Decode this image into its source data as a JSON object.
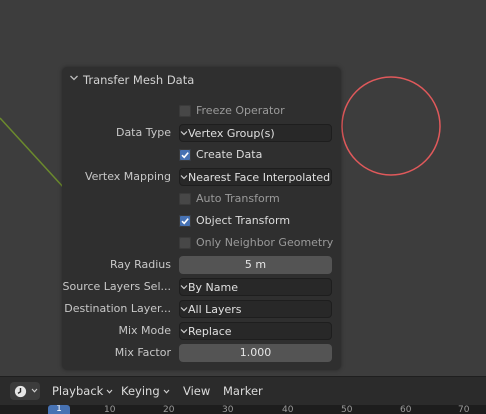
{
  "operator_panel": {
    "title": "Transfer Mesh Data",
    "freeze_operator": {
      "label": "Freeze Operator",
      "checked": false
    },
    "data_type": {
      "label": "Data Type",
      "value": "Vertex Group(s)"
    },
    "create_data": {
      "label": "Create Data",
      "checked": true
    },
    "vertex_mapping": {
      "label": "Vertex Mapping",
      "value": "Nearest Face Interpolated"
    },
    "auto_transform": {
      "label": "Auto Transform",
      "checked": false
    },
    "object_transform": {
      "label": "Object Transform",
      "checked": true
    },
    "only_neighbor_geometry": {
      "label": "Only Neighbor Geometry",
      "checked": false
    },
    "ray_radius": {
      "label": "Ray Radius",
      "value": "5 m"
    },
    "source_layers": {
      "label": "Source Layers Sel...",
      "value": "By Name"
    },
    "destination_layers": {
      "label": "Destination Layer...",
      "value": "All Layers"
    },
    "mix_mode": {
      "label": "Mix Mode",
      "value": "Replace"
    },
    "mix_factor": {
      "label": "Mix Factor",
      "value": "1.000"
    }
  },
  "timeline": {
    "menus": {
      "playback": "Playback",
      "keying": "Keying",
      "view": "View",
      "marker": "Marker"
    },
    "current_frame": "1",
    "ticks": [
      "10",
      "20",
      "30",
      "40",
      "50",
      "60",
      "70"
    ]
  },
  "colors": {
    "accent": "#4772b3",
    "brush_circle": "#e0595b",
    "axis_line": "#6b8a2d"
  },
  "icons": {
    "editor_type": "clock-icon",
    "panel_collapse": "chevron-down-icon"
  }
}
